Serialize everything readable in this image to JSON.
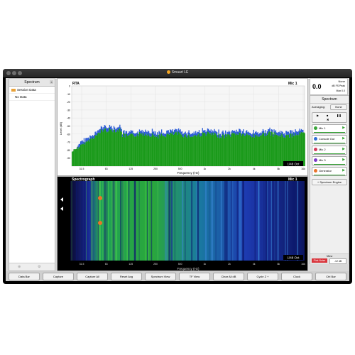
{
  "app": {
    "title": "Smaart LE"
  },
  "left_panel": {
    "header": "Spectrum",
    "items": [
      {
        "label": "Session Data"
      },
      {
        "label": "No Data"
      }
    ]
  },
  "rta": {
    "label": "RTA",
    "mic_label": "Mic 1",
    "y_axis_label": "Level (dB)",
    "x_axis_label": "Frequency (Hz)",
    "y_ticks": [
      "0",
      "-10",
      "-20",
      "-30",
      "-40",
      "-50",
      "-60",
      "-70",
      "-80",
      "-90"
    ],
    "x_ticks": [
      "31.5",
      "63",
      "125",
      "250",
      "500",
      "1k",
      "2k",
      "4k",
      "8k",
      "16k"
    ],
    "resolution": "1/48 Oct",
    "colors": {
      "green": "#1a9a1a",
      "blue": "#2b5bd6"
    }
  },
  "spectrograph": {
    "label": "Spectrograph",
    "mic_label": "Mic 1",
    "x_axis_label": "Frequency (Hz)",
    "x_ticks": [
      "31.5",
      "63",
      "125",
      "250",
      "500",
      "1k",
      "2k",
      "4k",
      "8k",
      "16k"
    ],
    "resolution": "1/48 Oct"
  },
  "meter": {
    "source": "None",
    "value": "0.0",
    "unit": "dB FS Peak",
    "max_label": "Max 0.0"
  },
  "right_panel": {
    "header": "Spectrum",
    "averaging_label": "Averaging:",
    "averaging_value": "None",
    "channels": [
      {
        "label": "Mic 1",
        "color": "#3aa53a"
      },
      {
        "label": "Console Out",
        "color": "#2f6fd6"
      },
      {
        "label": "Mic 2",
        "color": "#d23a5a"
      },
      {
        "label": "Mic 3",
        "color": "#7a3ac8"
      },
      {
        "label": "Generator",
        "color": "#e8742a"
      }
    ],
    "spectrum_engine": "+ Spectrum Engine",
    "view_label": "View",
    "pink_noise": "Pink Noise",
    "gen_level": "-12 dB"
  },
  "bottom_bar": [
    "Data Bar",
    "Capture",
    "Capture All",
    "Reset Avg",
    "Spectrum View",
    "TF View",
    "Clear All dB",
    "Cycle Z +",
    "Clock",
    "Ctrl Bar"
  ]
}
